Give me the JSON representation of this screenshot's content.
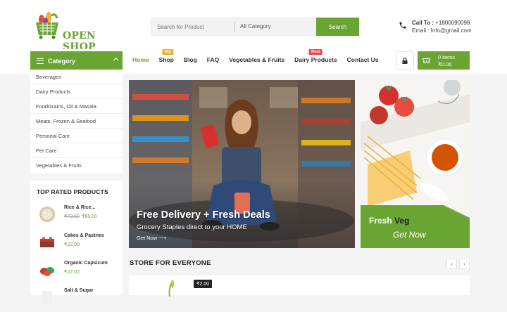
{
  "header": {
    "logo_text": "OPEN SHOP",
    "search_placeholder": "Search for Product",
    "category_select": "All Category",
    "search_button": "Search",
    "contact_call_label": "Call To :",
    "contact_phone": "+1800090098",
    "contact_email": "Email : Info@gmail.com"
  },
  "nav": {
    "category_button": "Category",
    "menu": [
      {
        "label": "Home",
        "badge": ""
      },
      {
        "label": "Shop",
        "badge": "Hot"
      },
      {
        "label": "Blog",
        "badge": ""
      },
      {
        "label": "FAQ",
        "badge": ""
      },
      {
        "label": "Vegetables & Fruits",
        "badge": ""
      },
      {
        "label": "Dairy Products",
        "badge": "Most"
      },
      {
        "label": "Contact Us",
        "badge": ""
      }
    ],
    "cart_items": "0 items",
    "cart_total": "₹0.00"
  },
  "sidebar": {
    "categories": [
      "Beverages",
      "Dairy Products",
      "FoodGrains, Oil & Masala",
      "Meats, Frozen & Seafood",
      "Personal Care",
      "Pet Care",
      "Vegetables & Fruits"
    ],
    "top_rated_title": "TOP RATED PRODUCTS",
    "top_rated": [
      {
        "name": "Rice & Rice...",
        "old_price": "₹70.00",
        "price": "₹65.00"
      },
      {
        "name": "Cakes & Pastries",
        "old_price": "",
        "price": "₹22.00"
      },
      {
        "name": "Organic Capsicum",
        "old_price": "",
        "price": "₹22.00"
      },
      {
        "name": "Salt & Sugar",
        "old_price": "",
        "price": ""
      }
    ]
  },
  "hero": {
    "title": "Free Delivery + Fresh Deals",
    "subtitle": "Grocery Staples direct to your HOME",
    "link": "Get Now"
  },
  "promo": {
    "title_part1": "Fresh",
    "title_part2": "Veg",
    "cta": "Get Now"
  },
  "store": {
    "title": "STORE FOR EVERYONE",
    "price_tag": "₹2.00",
    "prev": "‹",
    "next": "›"
  },
  "colors": {
    "accent": "#6aa533",
    "hot_badge": "#f3b22a",
    "most_badge": "#e5484d"
  }
}
